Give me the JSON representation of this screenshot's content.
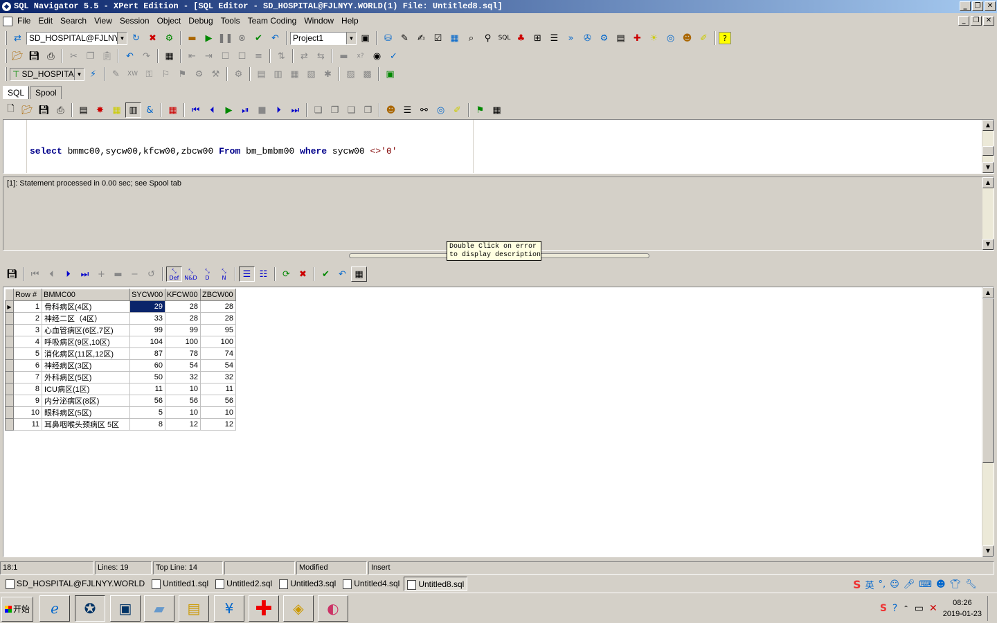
{
  "window": {
    "title": "SQL Navigator 5.5 - XPert Edition - [SQL Editor - SD_HOSPITAL@FJLNYY.WORLD(1) File: Untitled8.sql]"
  },
  "menu": [
    "File",
    "Edit",
    "Search",
    "View",
    "Session",
    "Object",
    "Debug",
    "Tools",
    "Team Coding",
    "Window",
    "Help"
  ],
  "toolbar": {
    "connection": "SD_HOSPITAL@FJLNYY.W",
    "project": "Project1",
    "schema": "SD_HOSPITAL"
  },
  "tabs": [
    "SQL",
    "Spool"
  ],
  "editor": {
    "kw_select": "select",
    "columns": " bmmc00,sycw00,kfcw00,zbcw00 ",
    "kw_from": "From",
    "table": " bm_bmbm00 ",
    "kw_where": "where",
    "cond_col": " sycw00 ",
    "cond_op": "<>",
    "cond_val": "'0'"
  },
  "messages": {
    "line": "[1]: Statement processed in 0.00 sec; see Spool tab"
  },
  "tooltip": "Double Click on error\nto display description",
  "grid_toolbar": {
    "def": "Def",
    "nd": "N&D",
    "d": "D",
    "n": "N"
  },
  "grid": {
    "headers": [
      "Row #",
      "BMMC00",
      "SYCW00",
      "KFCW00",
      "ZBCW00"
    ],
    "rows": [
      {
        "n": "1",
        "name": "骨科病区(4区)",
        "sy": "29",
        "kf": "28",
        "zb": "28"
      },
      {
        "n": "2",
        "name": "神经二区（4区）",
        "sy": "33",
        "kf": "28",
        "zb": "28"
      },
      {
        "n": "3",
        "name": "心血管病区(6区,7区)",
        "sy": "99",
        "kf": "99",
        "zb": "95"
      },
      {
        "n": "4",
        "name": "呼吸病区(9区,10区)",
        "sy": "104",
        "kf": "100",
        "zb": "100"
      },
      {
        "n": "5",
        "name": "消化病区(11区,12区)",
        "sy": "87",
        "kf": "78",
        "zb": "74"
      },
      {
        "n": "6",
        "name": "神经病区(3区)",
        "sy": "60",
        "kf": "54",
        "zb": "54"
      },
      {
        "n": "7",
        "name": "外科病区(5区)",
        "sy": "50",
        "kf": "32",
        "zb": "32"
      },
      {
        "n": "8",
        "name": "ICU病区(1区)",
        "sy": "11",
        "kf": "10",
        "zb": "11"
      },
      {
        "n": "9",
        "name": "内分泌病区(8区)",
        "sy": "56",
        "kf": "56",
        "zb": "56"
      },
      {
        "n": "10",
        "name": "眼科病区(5区)",
        "sy": "5",
        "kf": "10",
        "zb": "10"
      },
      {
        "n": "11",
        "name": "耳鼻咽喉头颈病区 5区",
        "sy": "8",
        "kf": "12",
        "zb": "12"
      }
    ]
  },
  "status": {
    "pos": "18:1",
    "lines": "Lines: 19",
    "topline": "Top Line: 14",
    "blank": "",
    "modified": "Modified",
    "mode": "Insert"
  },
  "windows": [
    "SD_HOSPITAL@FJLNYY.WORLD",
    "Untitled1.sql",
    "Untitled2.sql",
    "Untitled3.sql",
    "Untitled4.sql",
    "Untitled8.sql"
  ],
  "ime": {
    "lang": "英"
  },
  "taskbar": {
    "start": "开始",
    "time": "08:26",
    "date": "2019-01-23"
  }
}
